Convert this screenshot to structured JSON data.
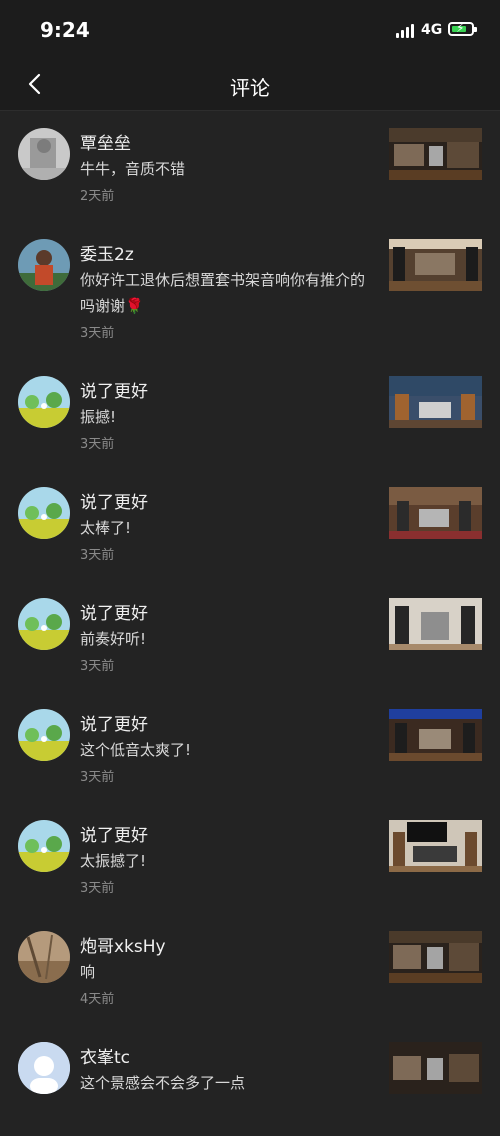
{
  "status": {
    "time": "9:24",
    "network": "4G"
  },
  "nav": {
    "title": "评论"
  },
  "comments": [
    {
      "user": "覃垒垒",
      "text": "牛牛，音质不错",
      "time": "2天前",
      "avatar": "gray-photo",
      "thumb": "record-player"
    },
    {
      "user": "委玉2z",
      "text": "你好许工退休后想置套书架音响你有推介的吗谢谢🌹",
      "time": "3天前",
      "avatar": "person-photo",
      "thumb": "speaker-room"
    },
    {
      "user": "说了更好",
      "text": "振撼!",
      "time": "3天前",
      "avatar": "landscape",
      "thumb": "hifi-setup-1"
    },
    {
      "user": "说了更好",
      "text": "太棒了!",
      "time": "3天前",
      "avatar": "landscape",
      "thumb": "hifi-setup-2"
    },
    {
      "user": "说了更好",
      "text": "前奏好听!",
      "time": "3天前",
      "avatar": "landscape",
      "thumb": "hifi-setup-3"
    },
    {
      "user": "说了更好",
      "text": "这个低音太爽了!",
      "time": "3天前",
      "avatar": "landscape",
      "thumb": "hifi-setup-4"
    },
    {
      "user": "说了更好",
      "text": "太振撼了!",
      "time": "3天前",
      "avatar": "landscape",
      "thumb": "tv-setup"
    },
    {
      "user": "炮哥xksHy",
      "text": "响",
      "time": "4天前",
      "avatar": "field-photo",
      "thumb": "record-player"
    },
    {
      "user": "衣峯tc",
      "text": "这个景感会不会多了一点",
      "time": "",
      "avatar": "default-user",
      "thumb": "record-player"
    }
  ]
}
